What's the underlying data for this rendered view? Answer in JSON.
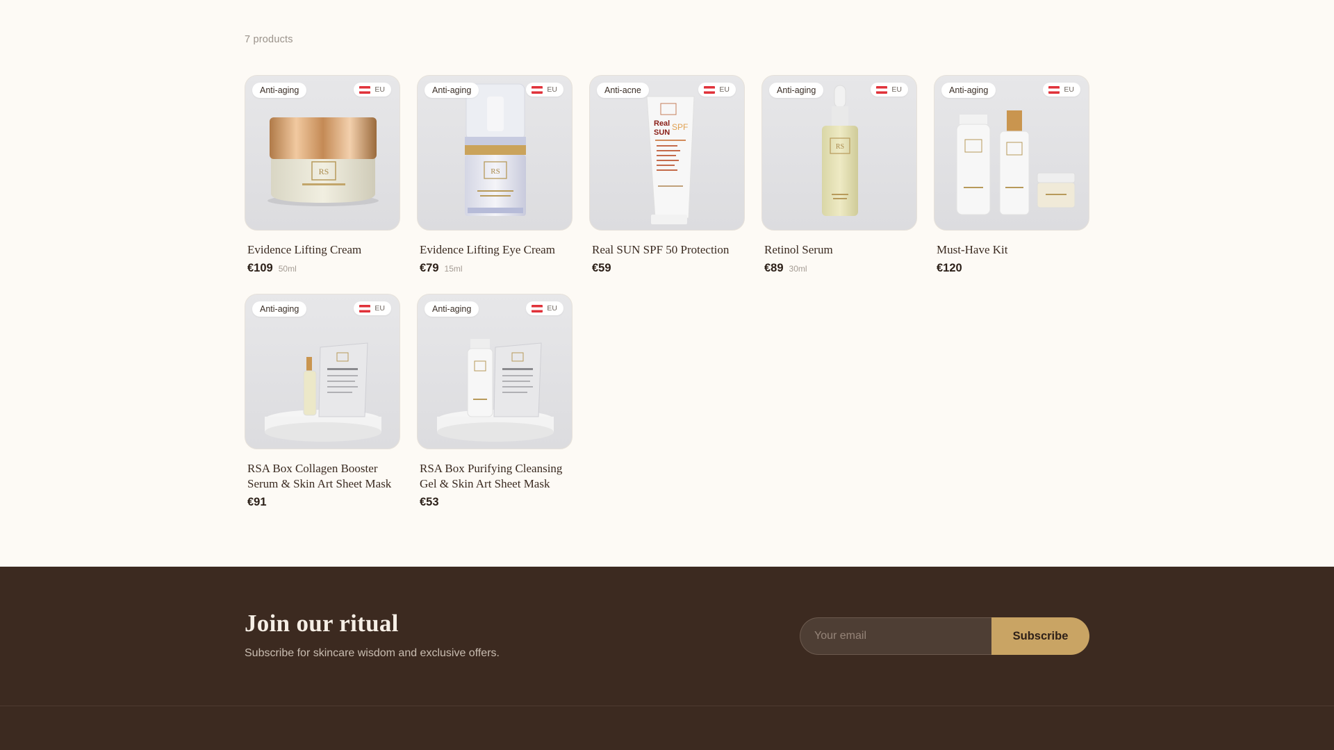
{
  "catalog": {
    "count_label": "7 products",
    "products": [
      {
        "category": "Anti-aging",
        "origin": "EU",
        "name": "Evidence Lifting Cream",
        "price": "€109",
        "size": "50ml",
        "art": "cream-jar"
      },
      {
        "category": "Anti-aging",
        "origin": "EU",
        "name": "Evidence Lifting Eye Cream",
        "price": "€79",
        "size": "15ml",
        "art": "eye-cream-bottle"
      },
      {
        "category": "Anti-acne",
        "origin": "EU",
        "name": "Real SUN SPF 50 Protection",
        "price": "€59",
        "size": "",
        "art": "sunscreen-tube"
      },
      {
        "category": "Anti-aging",
        "origin": "EU",
        "name": "Retinol Serum",
        "price": "€89",
        "size": "30ml",
        "art": "serum-dropper"
      },
      {
        "category": "Anti-aging",
        "origin": "EU",
        "name": "Must-Have Kit",
        "price": "€120",
        "size": "",
        "art": "kit-bottles"
      },
      {
        "category": "Anti-aging",
        "origin": "EU",
        "name": "RSA Box Collagen Booster Serum & Skin Art Sheet Mask",
        "price": "€91",
        "size": "",
        "art": "box-serum-mask"
      },
      {
        "category": "Anti-aging",
        "origin": "EU",
        "name": "RSA Box Purifying Cleansing Gel & Skin Art Sheet Mask",
        "price": "€53",
        "size": "",
        "art": "box-gel-mask"
      }
    ]
  },
  "newsletter": {
    "title": "Join our ritual",
    "subtitle": "Subscribe for skincare wisdom and exclusive offers.",
    "email_placeholder": "Your email",
    "subscribe_label": "Subscribe"
  },
  "colors": {
    "page_bg": "#fdfaf5",
    "footer_bg": "#3c2a20",
    "accent_gold": "#c9a464",
    "flag_red": "#e0323a"
  }
}
